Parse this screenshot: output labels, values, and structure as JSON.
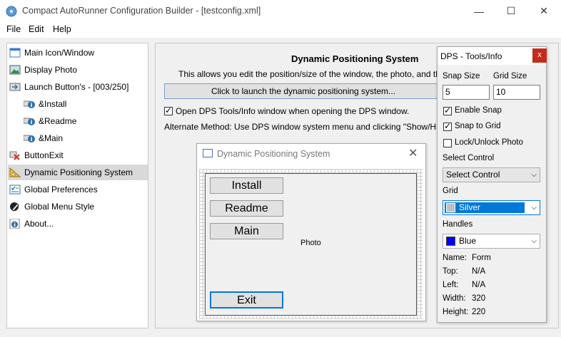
{
  "window": {
    "title": "Compact AutoRunner Configuration Builder - [testconfig.xml]",
    "minimize": "—",
    "maximize": "☐",
    "close": "✕"
  },
  "menu": [
    "File",
    "Edit",
    "Help"
  ],
  "tree": [
    {
      "label": "Main Icon/Window",
      "icon": "window-icon"
    },
    {
      "label": "Display Photo",
      "icon": "photo-icon"
    },
    {
      "label": "Launch Button's - [003/250]",
      "icon": "launch-icon"
    },
    {
      "label": "&Install",
      "icon": "info-button-icon"
    },
    {
      "label": "&Readme",
      "icon": "info-button-icon"
    },
    {
      "label": "&Main",
      "icon": "info-button-icon"
    },
    {
      "label": "ButtonExit",
      "icon": "exit-icon"
    },
    {
      "label": "Dynamic Positioning System",
      "icon": "ruler-icon"
    },
    {
      "label": "Global Preferences",
      "icon": "checklist-icon"
    },
    {
      "label": "Global Menu Style",
      "icon": "pen-icon"
    },
    {
      "label": "About...",
      "icon": "info-icon"
    }
  ],
  "panel": {
    "heading": "Dynamic Positioning System",
    "description": "This allows you edit the position/size of the window, the photo, and the curr",
    "launch_button": "Click to launch the dynamic positioning system...",
    "open_dps_label": "Open DPS Tools/Info window when opening the DPS window.",
    "alt_method": "Alternate Method: Use DPS window system menu and clicking \"Show/Hide DPS To"
  },
  "dps_window": {
    "title": "Dynamic Positioning System",
    "close": "✕",
    "buttons": [
      "Install",
      "Readme",
      "Main"
    ],
    "exit": "Exit",
    "photo": "Photo"
  },
  "tools": {
    "title": "DPS - Tools/Info",
    "close": "x",
    "snap_size_label": "Snap Size",
    "grid_size_label": "Grid Size",
    "snap_size": "5",
    "grid_size": "10",
    "enable_snap": "Enable Snap",
    "snap_to_grid": "Snap to Grid",
    "lock_photo": "Lock/Unlock Photo",
    "select_control_label": "Select Control",
    "select_control_value": "Select Control",
    "grid_label": "Grid",
    "grid_value": "Silver",
    "handles_label": "Handles",
    "handles_value": "Blue",
    "info": [
      {
        "k": "Name:",
        "v": "Form"
      },
      {
        "k": "Top:",
        "v": "N/A"
      },
      {
        "k": "Left:",
        "v": "N/A"
      },
      {
        "k": "Width:",
        "v": "320"
      },
      {
        "k": "Height:",
        "v": "220"
      }
    ]
  },
  "colors": {
    "grid_swatch": "#c0c0c0",
    "handles_swatch": "#0000ff",
    "selection": "#0078d7"
  }
}
